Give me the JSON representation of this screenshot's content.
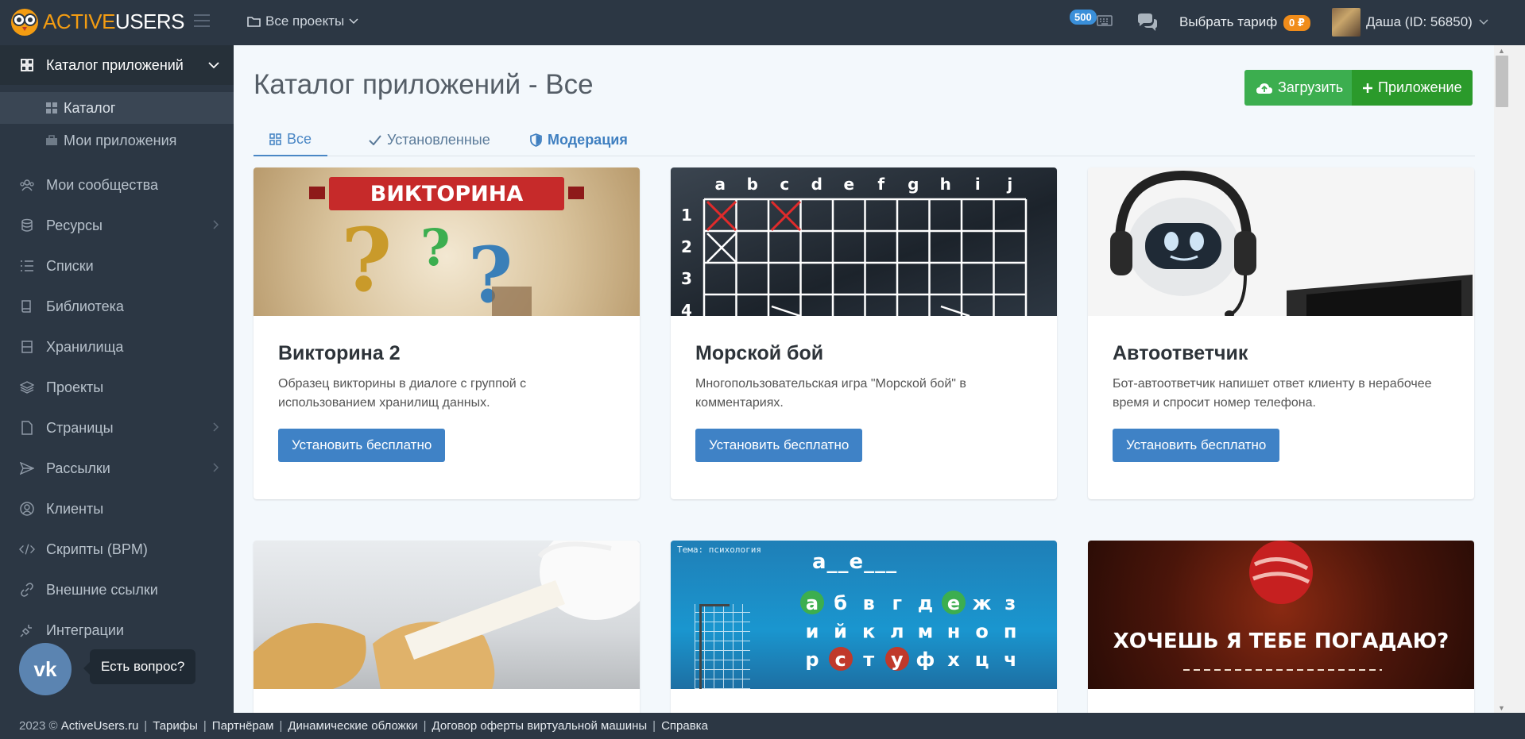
{
  "brand": {
    "part1": "ACTIVE",
    "part2": "USERS"
  },
  "topbar": {
    "projects_label": "Все проекты",
    "counter_badge": "500",
    "tariff_label": "Выбрать тариф",
    "balance": "0 ₽",
    "user_label": "Даша (ID: 56850)"
  },
  "sidebar": {
    "catalog_section": "Каталог приложений",
    "sub_items": [
      {
        "label": "Каталог"
      },
      {
        "label": "Мои приложения"
      }
    ],
    "items": [
      {
        "label": "Мои сообщества",
        "icon": "community-icon"
      },
      {
        "label": "Ресурсы",
        "icon": "database-icon"
      },
      {
        "label": "Списки",
        "icon": "list-icon"
      },
      {
        "label": "Библиотека",
        "icon": "book-icon"
      },
      {
        "label": "Хранилища",
        "icon": "storage-icon"
      },
      {
        "label": "Проекты",
        "icon": "layers-icon"
      },
      {
        "label": "Страницы",
        "icon": "file-icon"
      },
      {
        "label": "Рассылки",
        "icon": "send-icon"
      },
      {
        "label": "Клиенты",
        "icon": "user-circle-icon"
      },
      {
        "label": "Скрипты (BPM)",
        "icon": "code-icon"
      },
      {
        "label": "Внешние ссылки",
        "icon": "link-icon"
      },
      {
        "label": "Интеграции",
        "icon": "plug-icon"
      }
    ]
  },
  "vk_widget": {
    "logo": "vk",
    "tooltip": "Есть вопрос?"
  },
  "main": {
    "title": "Каталог приложений - Все",
    "upload_button": "Загрузить",
    "add_button": "Приложение",
    "tabs": [
      {
        "label": "Все"
      },
      {
        "label": "Установленные"
      },
      {
        "label": "Модерация"
      }
    ],
    "cards": [
      {
        "title": "Викторина 2",
        "description": "Образец викторины в диалоге с группой с использованием хранилищ данных.",
        "button": "Установить бесплатно",
        "image_text": "ВИКТОРИНА"
      },
      {
        "title": "Морской бой",
        "description": "Многопользовательская игра \"Морской бой\" в комментариях.",
        "button": "Установить бесплатно",
        "image_cols": [
          "a",
          "b",
          "c",
          "d",
          "e",
          "f",
          "g",
          "h",
          "i",
          "j"
        ],
        "image_rows": [
          "1",
          "2",
          "3",
          "4"
        ]
      },
      {
        "title": "Автоответчик",
        "description": "Бот-автоответчик напишет ответ клиенту в нерабочее время и спросит номер телефона.",
        "button": "Установить бесплатно"
      },
      {
        "image_text": ""
      },
      {
        "image_topic": "Тема: психология",
        "image_word": "а__е___",
        "image_letters": [
          "а",
          "б",
          "в",
          "г",
          "д",
          "е",
          "ж",
          "з",
          "и",
          "й",
          "к",
          "л",
          "м",
          "н",
          "о",
          "п",
          "р",
          "с",
          "т",
          "у",
          "ф",
          "х",
          "ц",
          "ч"
        ]
      },
      {
        "image_text": "ХОЧЕШЬ Я ТЕБЕ ПОГАДАЮ?"
      }
    ]
  },
  "footer": {
    "copyright": "2023 ©",
    "links": [
      "ActiveUsers.ru",
      "Тарифы",
      "Партнёрам",
      "Динамические обложки",
      "Договор оферты виртуальной машины",
      "Справка"
    ]
  },
  "colors": {
    "sidebar_bg": "#2c3744",
    "accent_blue": "#3f82c6",
    "green": "#3cae4f",
    "orange": "#f08c1a"
  }
}
